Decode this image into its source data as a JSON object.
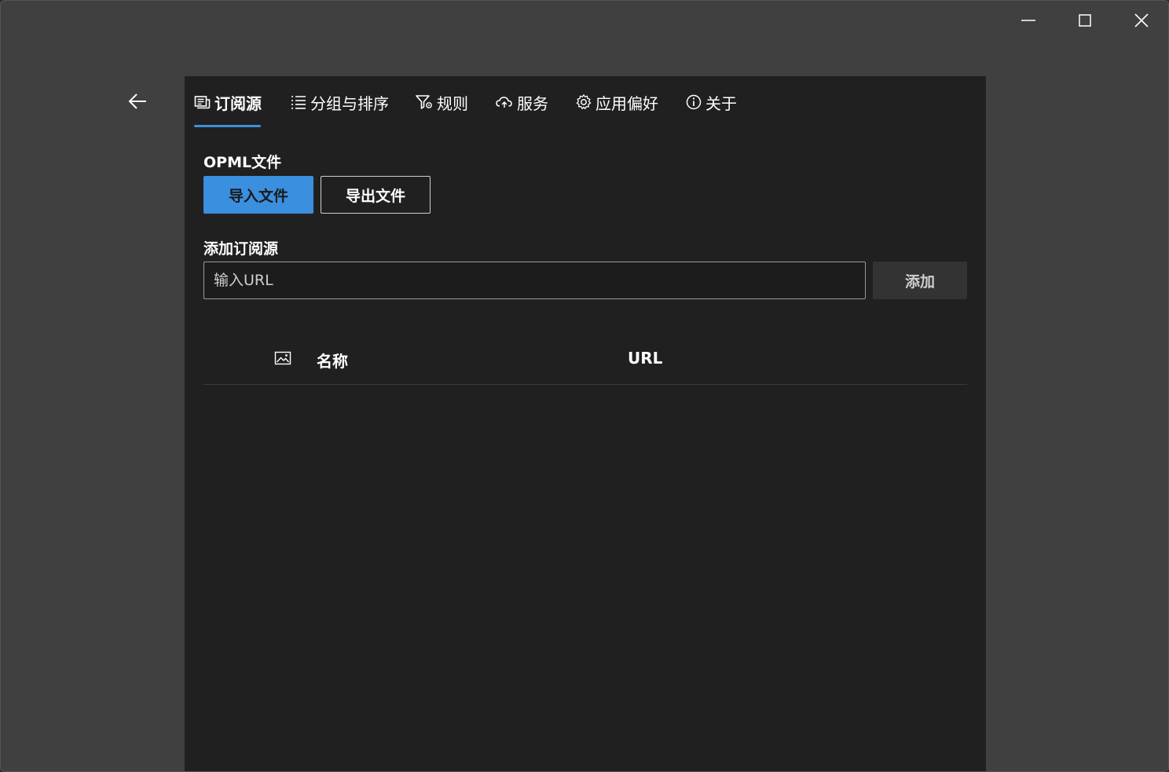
{
  "window": {
    "caption": {
      "minimize_icon": "minimize-icon",
      "maximize_icon": "maximize-icon",
      "close_icon": "close-icon"
    }
  },
  "nav": {
    "back_icon": "arrow-left-icon"
  },
  "tabs": [
    {
      "label": "订阅源",
      "icon": "feed-icon",
      "active": true
    },
    {
      "label": "分组与排序",
      "icon": "list-icon",
      "active": false
    },
    {
      "label": "规则",
      "icon": "filter-icon",
      "active": false
    },
    {
      "label": "服务",
      "icon": "cloud-sync-icon",
      "active": false
    },
    {
      "label": "应用偏好",
      "icon": "gear-icon",
      "active": false
    },
    {
      "label": "关于",
      "icon": "info-icon",
      "active": false
    }
  ],
  "opml": {
    "label": "OPML文件",
    "import_label": "导入文件",
    "export_label": "导出文件"
  },
  "add_source": {
    "label": "添加订阅源",
    "placeholder": "输入URL",
    "value": "",
    "add_label": "添加"
  },
  "table": {
    "icon_column": "image-icon",
    "name_header": "名称",
    "url_header": "URL",
    "rows": []
  },
  "colors": {
    "accent": "#3b8fdf",
    "panel": "#202020",
    "window": "#404040"
  }
}
